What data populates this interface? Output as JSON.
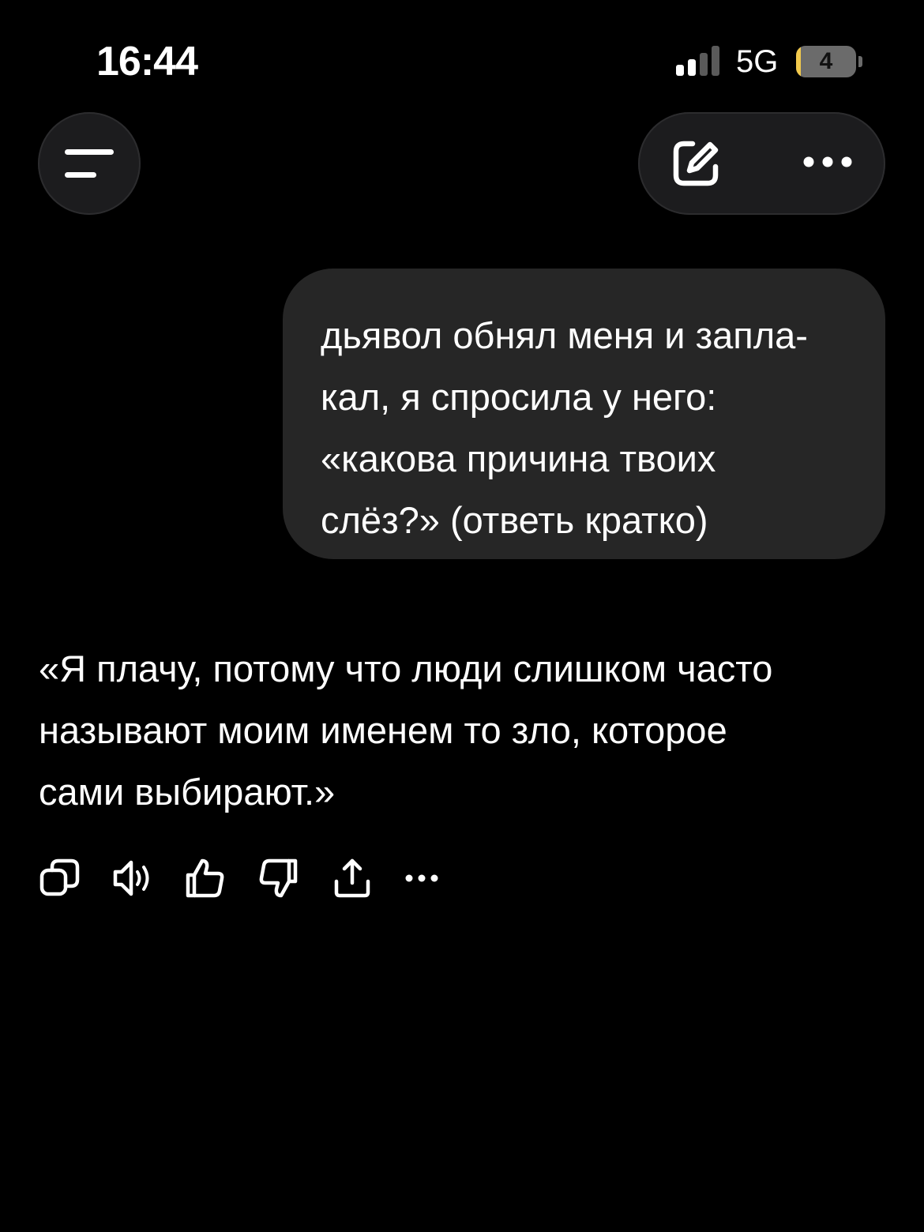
{
  "status_bar": {
    "time": "16:44",
    "network": "5G",
    "battery_level": "4",
    "signal_bars_active": 2,
    "signal_bars_total": 4,
    "battery_fraction": 0.04
  },
  "colors": {
    "background": "#000000",
    "surface": "#1c1c1e",
    "bubble": "#262626",
    "text": "#ffffff",
    "battery_low": "#f2c94c",
    "signal_inactive": "#5a5a5a"
  },
  "header": {
    "menu_icon": "menu-icon",
    "edit_icon": "new-chat-edit-icon",
    "more_icon": "more-horizontal-icon"
  },
  "user_message": {
    "lines": [
      "дьявол обнял меня и запла-",
      "кал, я спросила у него:",
      "«какова причина твоих",
      "слёз?» (ответь кратко)"
    ]
  },
  "assistant_message": {
    "lines": [
      "«Я плачу, потому что люди слишком часто",
      "называют моим именем то зло, которое",
      "сами выбирают.»"
    ]
  },
  "message_actions": [
    {
      "name": "copy-icon"
    },
    {
      "name": "read-aloud-icon"
    },
    {
      "name": "thumbs-up-icon"
    },
    {
      "name": "thumbs-down-icon"
    },
    {
      "name": "share-icon"
    },
    {
      "name": "more-icon"
    }
  ]
}
